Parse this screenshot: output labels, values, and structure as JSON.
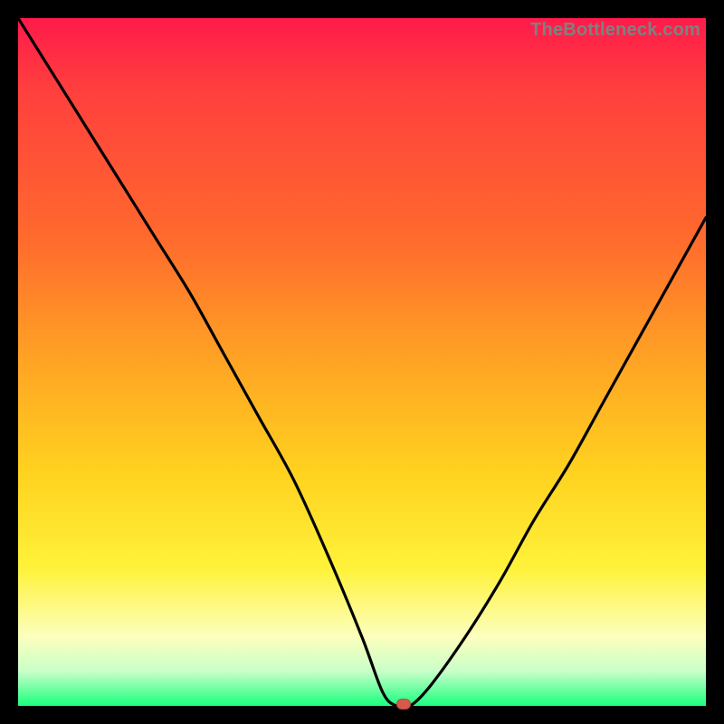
{
  "attribution": "TheBottleneck.com",
  "chart_data": {
    "type": "line",
    "title": "",
    "xlabel": "",
    "ylabel": "",
    "xlim": [
      0,
      100
    ],
    "ylim": [
      0,
      100
    ],
    "x": [
      0,
      5,
      10,
      15,
      20,
      25,
      30,
      35,
      40,
      45,
      50,
      53,
      55,
      57,
      60,
      65,
      70,
      75,
      80,
      85,
      90,
      95,
      100
    ],
    "values": [
      100,
      92,
      84,
      76,
      68,
      60,
      51,
      42,
      33,
      22,
      10,
      2,
      0,
      0,
      3,
      10,
      18,
      27,
      35,
      44,
      53,
      62,
      71
    ],
    "min_marker": {
      "x": 56,
      "y": 0
    },
    "background_gradient": [
      "#ff1a4b",
      "#ff6a2d",
      "#ffd21f",
      "#fcffbe",
      "#19ff7e"
    ]
  }
}
